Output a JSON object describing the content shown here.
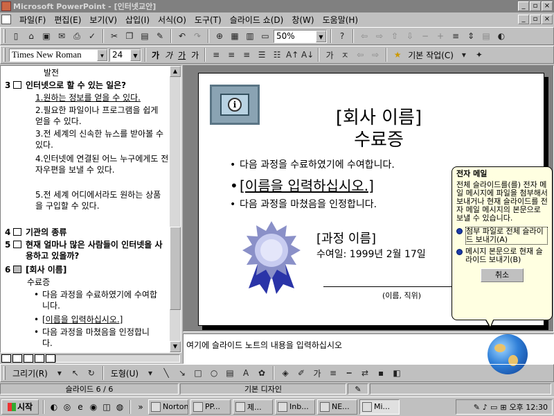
{
  "window": {
    "title": "Microsoft PowerPoint - [인터넷교안]",
    "controls": [
      "_",
      "▫",
      "×"
    ]
  },
  "menubar": {
    "items": [
      "파일(F)",
      "편집(E)",
      "보기(V)",
      "삽입(I)",
      "서식(O)",
      "도구(T)",
      "슬라이드 쇼(D)",
      "창(W)",
      "도움말(H)"
    ]
  },
  "toolbar": {
    "zoom": "50%",
    "font_name": "Times New Roman",
    "font_size": "24",
    "format_buttons": [
      "가",
      "가",
      "가",
      "가"
    ],
    "task_menu": "기본 작업(C)"
  },
  "outline": {
    "items": [
      {
        "text": "발전"
      },
      {
        "num": "3",
        "text": "인터넷으로 할 수 있는 일은?"
      },
      {
        "text": "1.원하는 정보를 얻을 수 있다."
      },
      {
        "text": "2.필요한 파일이나 프로그램을 쉽게 얻을 수 있다."
      },
      {
        "text": "3.전 세계의 신속한 뉴스를 받아볼 수 있다."
      },
      {
        "text": "4.인터넷에 연결된 어느 누구에게도 전자우편을 보낼 수 있다."
      },
      {
        "text": "5.전 세계 어디에서라도 원하는 상품을 구입할 수 있다."
      },
      {
        "num": "4",
        "text": "기관의 종류"
      },
      {
        "num": "5",
        "text": "현재 얼마나 많은 사람들이 인터넷을 사용하고 있을까?"
      },
      {
        "num": "6",
        "text": "[회사 이름]"
      },
      {
        "text": "수료증"
      },
      {
        "text": "다음 과정을 수료하였기에 수여합니다."
      },
      {
        "text": "[이름을 입력하십시오.]"
      },
      {
        "text": "다음 과정을 마쳤음을 인정합니다."
      }
    ]
  },
  "slide": {
    "title_line1": "[회사 이름]",
    "title_line2": "수료증",
    "bullet1": "다음 과정을 수료하였기에 수여합니다.",
    "bullet2": "[이름을 입력하십시오.]",
    "bullet3": "다음 과정을 마쳤음을 인정합니다.",
    "course": "[과정 이름]",
    "date": "수여일: 1999년 2월 17일",
    "signature_label": "(이름, 직위)"
  },
  "notes": {
    "placeholder": "여기에 슬라이드 노트의 내용을 입력하십시오"
  },
  "callout": {
    "title": "전자 메일",
    "body": "전체 슬라이드를(를) 전자 메일 메시지에 파일을 첨부해서 보내거나 현재 슬라이드를 전자 메일 메시지의 본문으로 보낼 수 있습니다.",
    "option1": "첨부 파일로 전체 슬라이드 보내기(A)",
    "option2": "메시지 본문으로 현재 슬라이드 보내기(B)",
    "cancel": "취소"
  },
  "drawbar": {
    "draw_menu": "그리기(R)",
    "autoshape_menu": "도형(U)"
  },
  "statusbar": {
    "slide_indicator": "슬라이드 6 / 6",
    "design": "기본 디자인"
  },
  "taskbar": {
    "start": "시작",
    "tasks": [
      "Norton...",
      "PP...",
      "제...",
      "Inb...",
      "NE...",
      "Mi..."
    ],
    "clock": "오후 12:30"
  }
}
